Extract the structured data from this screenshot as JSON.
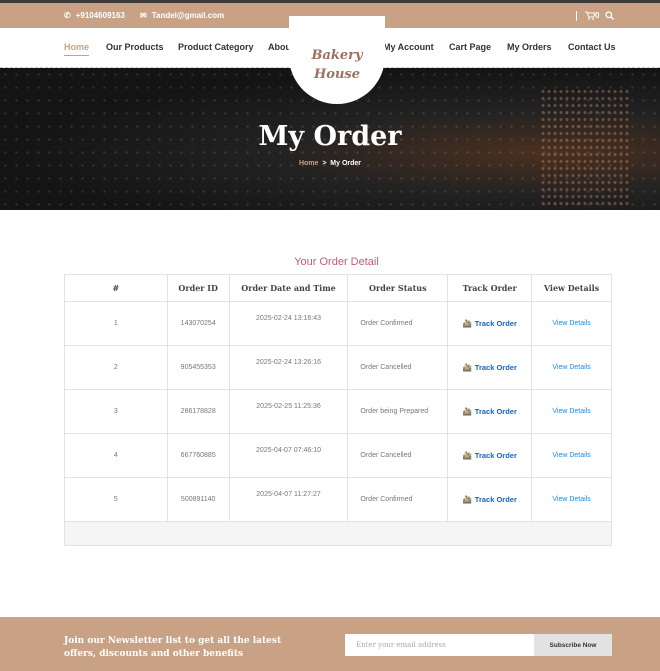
{
  "topbar": {
    "phone": "+9104609163",
    "email": "Tandel@gmail.com",
    "cart_count": "0"
  },
  "nav": {
    "left": [
      "Home",
      "Our Products",
      "Product Category",
      "About Us"
    ],
    "right": [
      "My Account",
      "Cart Page",
      "My Orders",
      "Contact Us"
    ]
  },
  "logo": {
    "line1": "Bakery",
    "line2": "House"
  },
  "hero": {
    "title": "My Order",
    "breadcrumb_home": "Home",
    "breadcrumb_sep": ">",
    "breadcrumb_current": "My Order"
  },
  "orders": {
    "title": "Your Order Detail",
    "headers": [
      "#",
      "Order ID",
      "Order Date and Time",
      "Order Status",
      "Track Order",
      "View Details"
    ],
    "track_label": "Track Order",
    "view_label": "View Details",
    "rows": [
      {
        "num": "1",
        "id": "143070254",
        "date": "2025-02-24 13:16:43",
        "status": "Order Confirmed"
      },
      {
        "num": "2",
        "id": "905455353",
        "date": "2025-02-24 13:26:16",
        "status": "Order Cancelled"
      },
      {
        "num": "3",
        "id": "286178828",
        "date": "2025-02-25 11:25:36",
        "status": "Order being Prepared"
      },
      {
        "num": "4",
        "id": "667760885",
        "date": "2025-04-07 07:46:10",
        "status": "Order Cancelled"
      },
      {
        "num": "5",
        "id": "500891140",
        "date": "2025-04-07 11:27:27",
        "status": "Order Confirmed"
      }
    ]
  },
  "footer": {
    "newsletter_text": "Join our Newsletter list to get all the latest offers, discounts and other benefits",
    "email_placeholder": "Enter your email address",
    "subscribe_label": "Subscribe Now"
  }
}
